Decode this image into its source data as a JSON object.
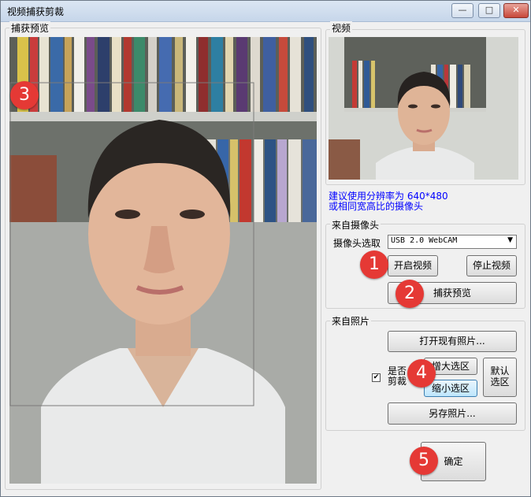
{
  "window": {
    "title": "视频捕获剪裁",
    "minimize_glyph": "—",
    "maximize_glyph": "□",
    "close_glyph": "✕"
  },
  "capture_preview": {
    "label": "捕获预览"
  },
  "video": {
    "label": "视频",
    "hint_line1": "建议使用分辨率为 640*480",
    "hint_line2": "或相同宽高比的摄像头",
    "hint_color": "#0000ff"
  },
  "camera": {
    "group_label": "来自摄像头",
    "select_label": "摄像头选取",
    "selected_camera": "USB 2.0 WebCAM",
    "start_button": "开启视频",
    "stop_button": "停止视频",
    "capture_button": "捕获预览"
  },
  "photo": {
    "group_label": "来自照片",
    "open_button": "打开现有照片...",
    "crop_checkbox_line1": "是否",
    "crop_checkbox_line2": "剪裁",
    "crop_checked": true,
    "enlarge_button": "增大选区",
    "shrink_button": "缩小选区",
    "default_line1": "默认",
    "default_line2": "选区",
    "save_button": "另存照片..."
  },
  "ok_button": "确定",
  "badges": [
    "1",
    "2",
    "3",
    "4",
    "5"
  ],
  "badge_color": "#e53935"
}
